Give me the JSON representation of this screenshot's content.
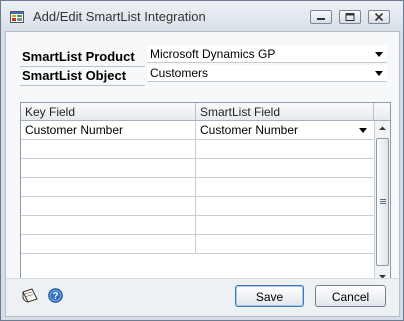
{
  "window": {
    "title": "Add/Edit SmartList Integration"
  },
  "form": {
    "product_label": "SmartList Product",
    "product_value": "Microsoft Dynamics GP",
    "object_label": "SmartList Object",
    "object_value": "Customers"
  },
  "grid": {
    "columns": [
      "Key Field",
      "SmartList Field"
    ],
    "rows": [
      [
        "Customer Number",
        "Customer Number"
      ],
      [
        "",
        ""
      ],
      [
        "",
        ""
      ],
      [
        "",
        ""
      ],
      [
        "",
        ""
      ],
      [
        "",
        ""
      ],
      [
        "",
        ""
      ]
    ]
  },
  "buttons": {
    "save": "Save",
    "cancel": "Cancel"
  },
  "icons": {
    "app": "smartlist-app-icon",
    "minimize": "minimize-icon",
    "maximize": "maximize-icon",
    "close": "close-icon",
    "note": "note-icon",
    "help": "help-icon"
  },
  "colors": {
    "help_blue": "#2f6fc3",
    "default_button_border": "#3f78b8"
  }
}
